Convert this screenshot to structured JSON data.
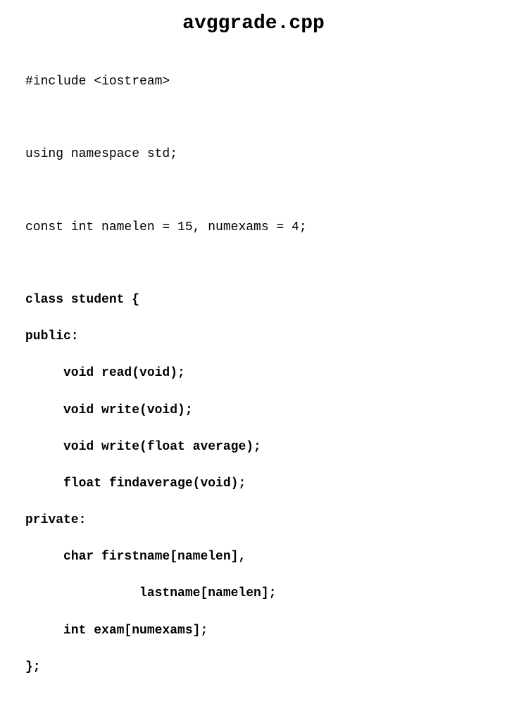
{
  "title": "avggrade.cpp",
  "lines": {
    "l1": "#include <iostream>",
    "l2": "using namespace std;",
    "l3": "const int namelen = 15, numexams = 4;",
    "l4": "class student {",
    "l5": "public:",
    "l6": "     void read(void);",
    "l7": "     void write(void);",
    "l8": "     void write(float average);",
    "l9": "     float findaverage(void);",
    "l10": "private:",
    "l11": "     char firstname[namelen],",
    "l12": "               lastname[namelen];",
    "l13": "     int exam[numexams];",
    "l14": "};"
  }
}
